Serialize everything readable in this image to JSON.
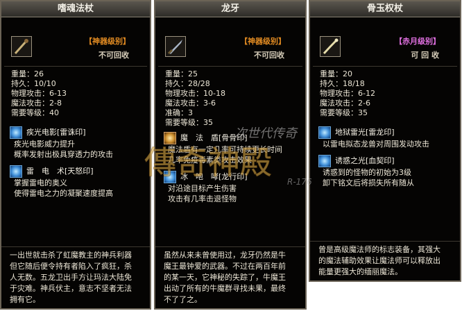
{
  "panels": [
    {
      "title": "嗜魂法杖",
      "grade": "【神器级别】",
      "grade_color": "#e08a22",
      "no_recycle": "不可回收",
      "stats": [
        "重量：26",
        "持久：10/10",
        "物理攻击：6-13",
        "魔法攻击：2-8",
        "需要等级：40"
      ],
      "skills": [
        {
          "name": "疾光电影[雷诛印]",
          "desc": [
            "疾光电影威力提升",
            "概率发射出极具穿透力的攻击"
          ]
        },
        {
          "name": "雷　电　术[天怒印]",
          "desc": [
            "掌握雷电的奥义",
            "使得雷电之力的凝聚速度提高"
          ]
        }
      ],
      "lore": [
        "一出世就击杀了虹魔教主的神兵利器",
        "但它随后便令持有者陷入了疯狂，杀",
        "人无数。五龙卫出手方让玛法大陆免",
        "于灾难。神兵伏主，意志不坚者无法",
        "拥有它。"
      ]
    },
    {
      "title": "龙牙",
      "grade": "【神器级别】",
      "grade_color": "#e08a22",
      "no_recycle": "不可回收",
      "stats": [
        "重量：25",
        "持久：28/28",
        "物理攻击：10-18",
        "魔法攻击：3-6",
        "准确：3",
        "需要等级：35"
      ],
      "skills": [
        {
          "name": "魔　法　盾[骨骨印]",
          "desc": [
            "魔法盾有一定几率可持续更长时间",
            "几率免疫毒素类攻击效果"
          ]
        },
        {
          "name": "冰　咆　哮[龙行印]",
          "desc": [
            "对沿途目标产生伤害",
            "攻击有几率击退怪物"
          ]
        }
      ],
      "lore": [
        "虽然从来未曾使用过，龙牙仍然是牛",
        "魔王最钟爱的武器。不过在两百年前",
        "的某一天，它神秘的失踪了，牛魔王",
        "出动了所有的牛魔群寻找未果，最终",
        "不了了之。"
      ]
    },
    {
      "title": "骨玉权杖",
      "grade": "【赤月级别】",
      "grade_color": "#e070e0",
      "no_recycle": "可 回 收",
      "stats": [
        "重量：20",
        "持久：18/18",
        "物理攻击：6-12",
        "魔法攻击：2-6",
        "需要等级：35"
      ],
      "skills": [
        {
          "name": "地狱雷光[雷龙印]",
          "desc": [
            "以雷电拟态龙兽对周围发动攻击"
          ]
        },
        {
          "name": "诱惑之光[血契印]",
          "desc": [
            "诱惑到的怪物的初始为3级",
            "卸下铭文后将损失所有随从"
          ]
        }
      ],
      "lore": [
        "曾是高级魔法师的标志装备，其强大",
        "的魔法辅助效果让魔法师可以释放出",
        "能量更强大的缅丽魔法。"
      ]
    }
  ],
  "watermark": {
    "top": "次世代传奇",
    "main": "傳奇神殿",
    "code": "R-176"
  }
}
